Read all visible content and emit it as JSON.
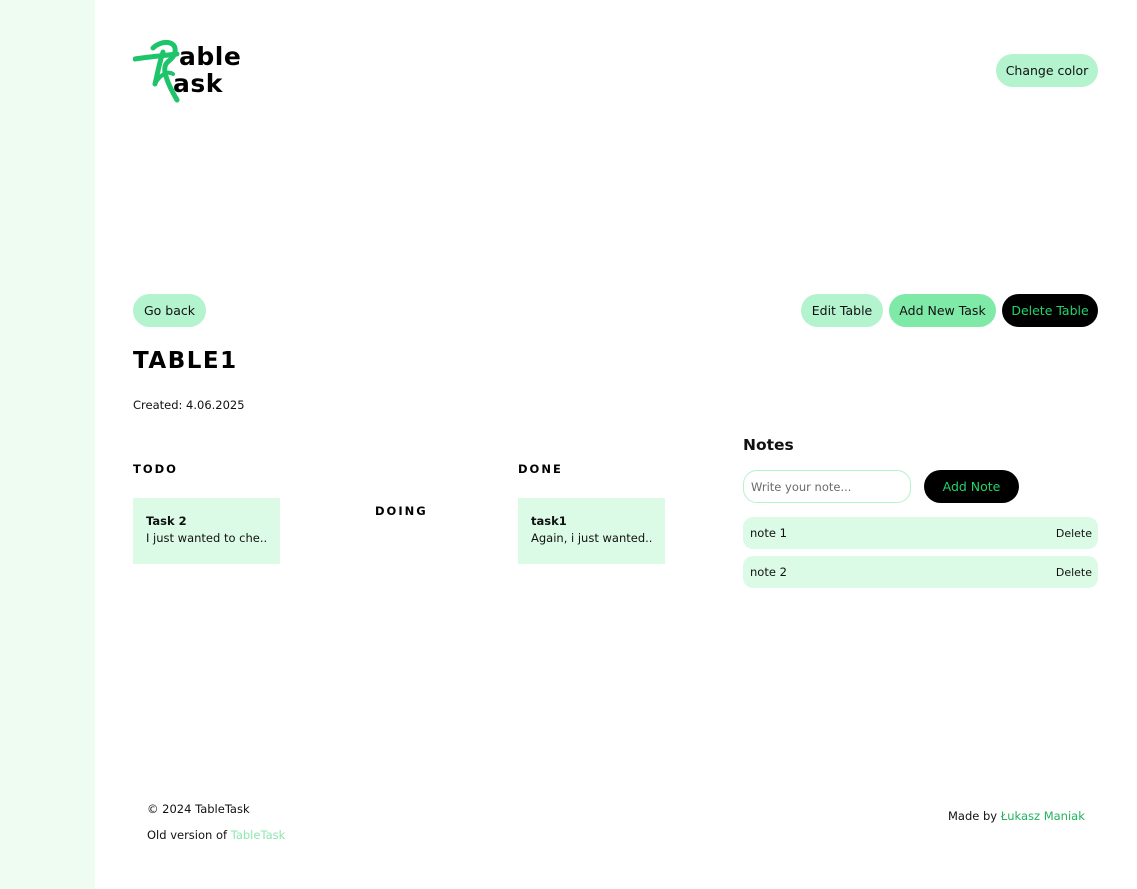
{
  "logo": {
    "line1": "able",
    "line2": "ask",
    "mark_color": "#1ec46a"
  },
  "header": {
    "change_color_label": "Change color"
  },
  "toolbar": {
    "go_back_label": "Go back",
    "edit_table_label": "Edit Table",
    "add_task_label": "Add New Task",
    "delete_table_label": "Delete Table"
  },
  "table": {
    "title": "TABLE1",
    "created": "Created: 4.06.2025"
  },
  "columns": {
    "todo": {
      "label": "TODO",
      "tasks": [
        {
          "title": "Task 2",
          "desc": "I just wanted to che..."
        }
      ]
    },
    "doing": {
      "label": "DOING",
      "tasks": []
    },
    "done": {
      "label": "DONE",
      "tasks": [
        {
          "title": "task1",
          "desc": "Again, i just wanted..."
        }
      ]
    }
  },
  "notes": {
    "title": "Notes",
    "placeholder": "Write your note...",
    "add_label": "Add Note",
    "items": [
      {
        "text": "note 1",
        "delete_label": "Delete"
      },
      {
        "text": "note 2",
        "delete_label": "Delete"
      }
    ]
  },
  "footer": {
    "copyright": "© 2024 TableTask",
    "old_version_prefix": "Old version of ",
    "old_version_link": "TableTask",
    "made_by_prefix": "Made by ",
    "author": "Łukasz Maniak"
  },
  "colors": {
    "accent": "#1ec46a",
    "light_green": "#b3f3cd",
    "mid_green": "#7fe9a8",
    "card_bg": "#dcfbe6",
    "side_bg": "#effcf2"
  }
}
